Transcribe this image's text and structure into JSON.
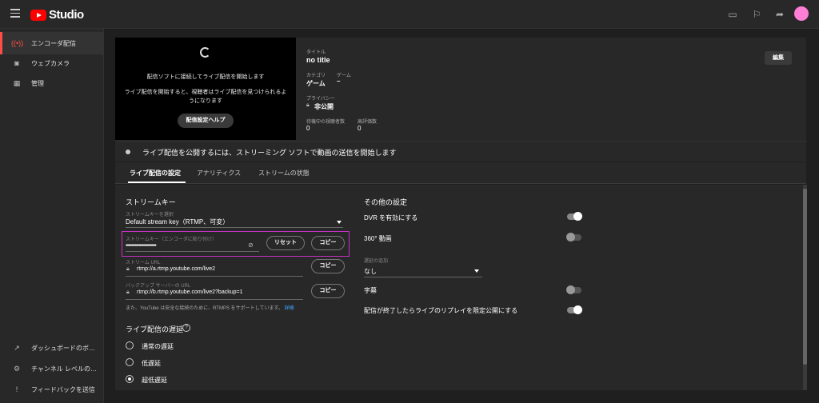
{
  "app": {
    "logo_text": "Studio"
  },
  "sidebar": {
    "items": [
      {
        "label": "エンコーダ配信",
        "icon": "broadcast-icon"
      },
      {
        "label": "ウェブカメラ",
        "icon": "camera-icon"
      },
      {
        "label": "管理",
        "icon": "calendar-icon"
      }
    ],
    "bottom_items": [
      {
        "label": "ダッシュボードのボ…",
        "icon": "external-link-icon"
      },
      {
        "label": "チャンネル レベルの…",
        "icon": "gear-icon"
      },
      {
        "label": "フィードバックを送信",
        "icon": "feedback-icon"
      }
    ]
  },
  "preview": {
    "line1": "配信ソフトに接続してライブ配信を開始します",
    "line2": "ライブ配信を開始すると、視聴者はライブ配信を見つけられるようになります",
    "help_button": "配信設定ヘルプ"
  },
  "info": {
    "title_label": "タイトル",
    "title_value": "no title",
    "category_label": "カテゴリ",
    "category_value": "ゲーム",
    "game_label": "ゲーム",
    "game_value": "–",
    "privacy_label": "プライバシー",
    "privacy_value": "非公開",
    "waiting_label": "待機中の視聴者数",
    "waiting_value": "0",
    "likes_label": "高評価数",
    "likes_value": "0",
    "edit_button": "編集"
  },
  "status": {
    "text": "ライブ配信を公開するには、ストリーミング ソフトで動画の送信を開始します"
  },
  "tabs": [
    {
      "label": "ライブ配信の設定",
      "active": true
    },
    {
      "label": "アナリティクス",
      "active": false
    },
    {
      "label": "ストリームの状態",
      "active": false
    }
  ],
  "stream_key": {
    "section_title": "ストリームキー",
    "select_label": "ストリームキーを選択",
    "select_value": "Default stream key（RTMP、可変）",
    "key_label": "ストリームキー（エンコーダに貼り付け）",
    "key_value": "••••••••••••••••••••••••••",
    "reset_button": "リセット",
    "copy_button": "コピー",
    "url_label": "ストリーム URL",
    "url_value": "rtmp://a.rtmp.youtube.com/live2",
    "url_copy": "コピー",
    "backup_label": "バックアップ サーバーの URL",
    "backup_value": "rtmp://b.rtmp.youtube.com/live2?backup=1",
    "backup_copy": "コピー",
    "note": "また、YouTube は安全な接続のために、RTMPS をサポートしています。",
    "note_link": "詳細"
  },
  "latency": {
    "title": "ライブ配信の遅延",
    "options": [
      {
        "label": "通常の遅延",
        "selected": false
      },
      {
        "label": "低遅延",
        "selected": false
      },
      {
        "label": "超低遅延",
        "selected": true
      }
    ]
  },
  "other": {
    "title": "その他の設定",
    "dvr_label": "DVR を有効にする",
    "dvr_on": true,
    "v360_label": "360° 動画",
    "v360_on": false,
    "delay_label": "遅延の追加",
    "delay_value": "なし",
    "captions_label": "字幕",
    "captions_on": false,
    "replay_label": "配信が終了したらライブのリプレイを限定公開にする",
    "replay_on": true
  }
}
